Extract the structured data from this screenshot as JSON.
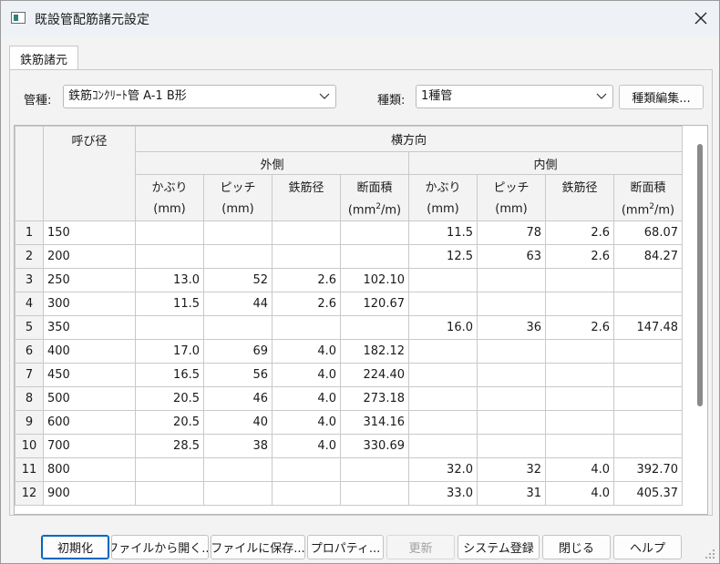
{
  "window": {
    "title": "既設管配筋諸元設定",
    "close_icon": "close-icon",
    "app_icon": "window-app-icon"
  },
  "tab": {
    "label": "鉄筋諸元"
  },
  "form": {
    "pipe_type_label": "管種:",
    "pipe_type_value": "鉄筋ｺﾝｸﾘｰﾄ管 A-1 B形",
    "kind_label": "種類:",
    "kind_value": "1種管",
    "edit_kinds_button": "種類編集..."
  },
  "table": {
    "diameter_header": "呼び径",
    "direction_header": "横方向",
    "outer_header": "外側",
    "inner_header": "内側",
    "col_cover": "かぶり",
    "col_pitch": "ピッチ",
    "col_bar_dia": "鉄筋径",
    "col_area": "断面積",
    "unit_mm": "(mm)",
    "unit_area_pre": "(mm",
    "unit_area_sup": "2",
    "unit_area_post": "/m)",
    "rows": [
      {
        "no": "1",
        "dia": "150",
        "o_cover": "",
        "o_pitch": "",
        "o_bar": "",
        "o_area": "",
        "i_cover": "11.5",
        "i_pitch": "78",
        "i_bar": "2.6",
        "i_area": "68.07"
      },
      {
        "no": "2",
        "dia": "200",
        "o_cover": "",
        "o_pitch": "",
        "o_bar": "",
        "o_area": "",
        "i_cover": "12.5",
        "i_pitch": "63",
        "i_bar": "2.6",
        "i_area": "84.27"
      },
      {
        "no": "3",
        "dia": "250",
        "o_cover": "13.0",
        "o_pitch": "52",
        "o_bar": "2.6",
        "o_area": "102.10",
        "i_cover": "",
        "i_pitch": "",
        "i_bar": "",
        "i_area": ""
      },
      {
        "no": "4",
        "dia": "300",
        "o_cover": "11.5",
        "o_pitch": "44",
        "o_bar": "2.6",
        "o_area": "120.67",
        "i_cover": "",
        "i_pitch": "",
        "i_bar": "",
        "i_area": ""
      },
      {
        "no": "5",
        "dia": "350",
        "o_cover": "",
        "o_pitch": "",
        "o_bar": "",
        "o_area": "",
        "i_cover": "16.0",
        "i_pitch": "36",
        "i_bar": "2.6",
        "i_area": "147.48"
      },
      {
        "no": "6",
        "dia": "400",
        "o_cover": "17.0",
        "o_pitch": "69",
        "o_bar": "4.0",
        "o_area": "182.12",
        "i_cover": "",
        "i_pitch": "",
        "i_bar": "",
        "i_area": ""
      },
      {
        "no": "7",
        "dia": "450",
        "o_cover": "16.5",
        "o_pitch": "56",
        "o_bar": "4.0",
        "o_area": "224.40",
        "i_cover": "",
        "i_pitch": "",
        "i_bar": "",
        "i_area": ""
      },
      {
        "no": "8",
        "dia": "500",
        "o_cover": "20.5",
        "o_pitch": "46",
        "o_bar": "4.0",
        "o_area": "273.18",
        "i_cover": "",
        "i_pitch": "",
        "i_bar": "",
        "i_area": ""
      },
      {
        "no": "9",
        "dia": "600",
        "o_cover": "20.5",
        "o_pitch": "40",
        "o_bar": "4.0",
        "o_area": "314.16",
        "i_cover": "",
        "i_pitch": "",
        "i_bar": "",
        "i_area": ""
      },
      {
        "no": "10",
        "dia": "700",
        "o_cover": "28.5",
        "o_pitch": "38",
        "o_bar": "4.0",
        "o_area": "330.69",
        "i_cover": "",
        "i_pitch": "",
        "i_bar": "",
        "i_area": ""
      },
      {
        "no": "11",
        "dia": "800",
        "o_cover": "",
        "o_pitch": "",
        "o_bar": "",
        "o_area": "",
        "i_cover": "32.0",
        "i_pitch": "32",
        "i_bar": "4.0",
        "i_area": "392.70"
      },
      {
        "no": "12",
        "dia": "900",
        "o_cover": "",
        "o_pitch": "",
        "o_bar": "",
        "o_area": "",
        "i_cover": "33.0",
        "i_pitch": "31",
        "i_bar": "4.0",
        "i_area": "405.37"
      }
    ]
  },
  "buttons": {
    "init": "初期化",
    "open_file": "ファイルから開く...",
    "save_file": "ファイルに保存...",
    "properties": "プロパティ...",
    "update": "更新",
    "system_register": "システム登録",
    "close": "閉じる",
    "help": "ヘルプ"
  },
  "colors": {
    "accent": "#0067c0",
    "titlebar": "#eef1f6",
    "dialog_bg": "#f3f3f3",
    "grid_line": "#c9c9c9"
  }
}
